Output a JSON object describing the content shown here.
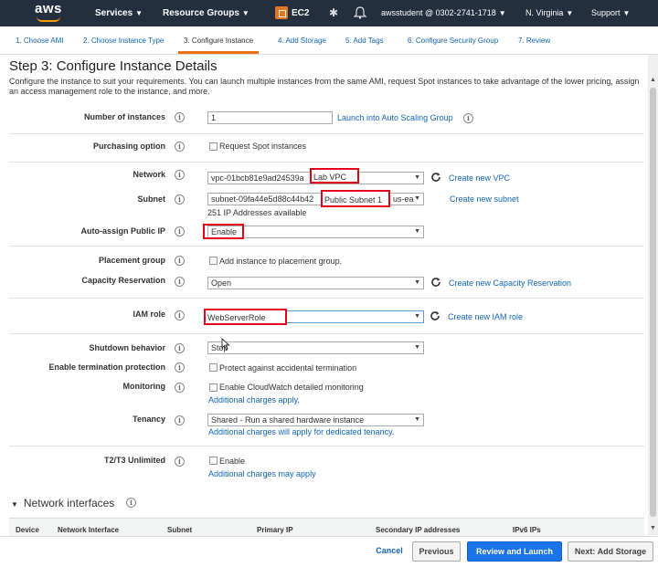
{
  "nav": {
    "logo": "aws",
    "services": "Services",
    "resource_groups": "Resource Groups",
    "service_name": "EC2",
    "account": "awsstudent @ 0302-2741-1718",
    "region": "N. Virginia",
    "support": "Support"
  },
  "tabs": [
    {
      "label": "1. Choose AMI"
    },
    {
      "label": "2. Choose Instance Type"
    },
    {
      "label": "3. Configure Instance"
    },
    {
      "label": "4. Add Storage"
    },
    {
      "label": "5. Add Tags"
    },
    {
      "label": "6. Configure Security Group"
    },
    {
      "label": "7. Review"
    }
  ],
  "page": {
    "title": "Step 3: Configure Instance Details",
    "description": "Configure the instance to suit your requirements. You can launch multiple instances from the same AMI, request Spot instances to take advantage of the lower pricing, assign an access management role to the instance, and more."
  },
  "form": {
    "num_instances_label": "Number of instances",
    "num_instances_value": "1",
    "launch_asg_link": "Launch into Auto Scaling Group",
    "purchasing_label": "Purchasing option",
    "spot_label": "Request Spot instances",
    "network_label": "Network",
    "network_value": "vpc-01bcb81e9ad24539a",
    "network_name": "Lab VPC",
    "create_vpc_link": "Create new VPC",
    "subnet_label": "Subnet",
    "subnet_value": "subnet-09fa44e5d88c44b42",
    "subnet_name": "Public Subnet 1",
    "subnet_az": "us-ea",
    "create_subnet_link": "Create new subnet",
    "ip_available": "251 IP Addresses available",
    "public_ip_label": "Auto-assign Public IP",
    "public_ip_value": "Enable",
    "placement_label": "Placement group",
    "placement_check_label": "Add instance to placement group.",
    "capacity_label": "Capacity Reservation",
    "capacity_value": "Open",
    "create_capacity_link": "Create new Capacity Reservation",
    "iam_label": "IAM role",
    "iam_value": "WebServerRole",
    "create_iam_link": "Create new IAM role",
    "shutdown_label": "Shutdown behavior",
    "shutdown_value": "Stop",
    "termination_label": "Enable termination protection",
    "termination_check_label": "Protect against accidental termination",
    "monitoring_label": "Monitoring",
    "monitoring_check_label": "Enable CloudWatch detailed monitoring",
    "monitoring_charges_link": "Additional charges apply.",
    "tenancy_label": "Tenancy",
    "tenancy_value": "Shared - Run a shared hardware instance",
    "tenancy_charges_link": "Additional charges will apply for dedicated tenancy.",
    "t2t3_label": "T2/T3 Unlimited",
    "t2t3_check_label": "Enable",
    "t2t3_charges_link": "Additional charges may apply"
  },
  "network_interfaces": {
    "title": "Network interfaces",
    "columns": [
      "Device",
      "Network Interface",
      "Subnet",
      "Primary IP",
      "Secondary IP addresses",
      "IPv6 IPs"
    ]
  },
  "footer": {
    "cancel": "Cancel",
    "previous": "Previous",
    "review_launch": "Review and Launch",
    "next": "Next: Add Storage"
  },
  "colors": {
    "nav_bg": "#232f3e",
    "accent": "#ec7211",
    "link": "#1166bb",
    "primary_button": "#1a73e8",
    "highlight_box": "#e3001b"
  }
}
